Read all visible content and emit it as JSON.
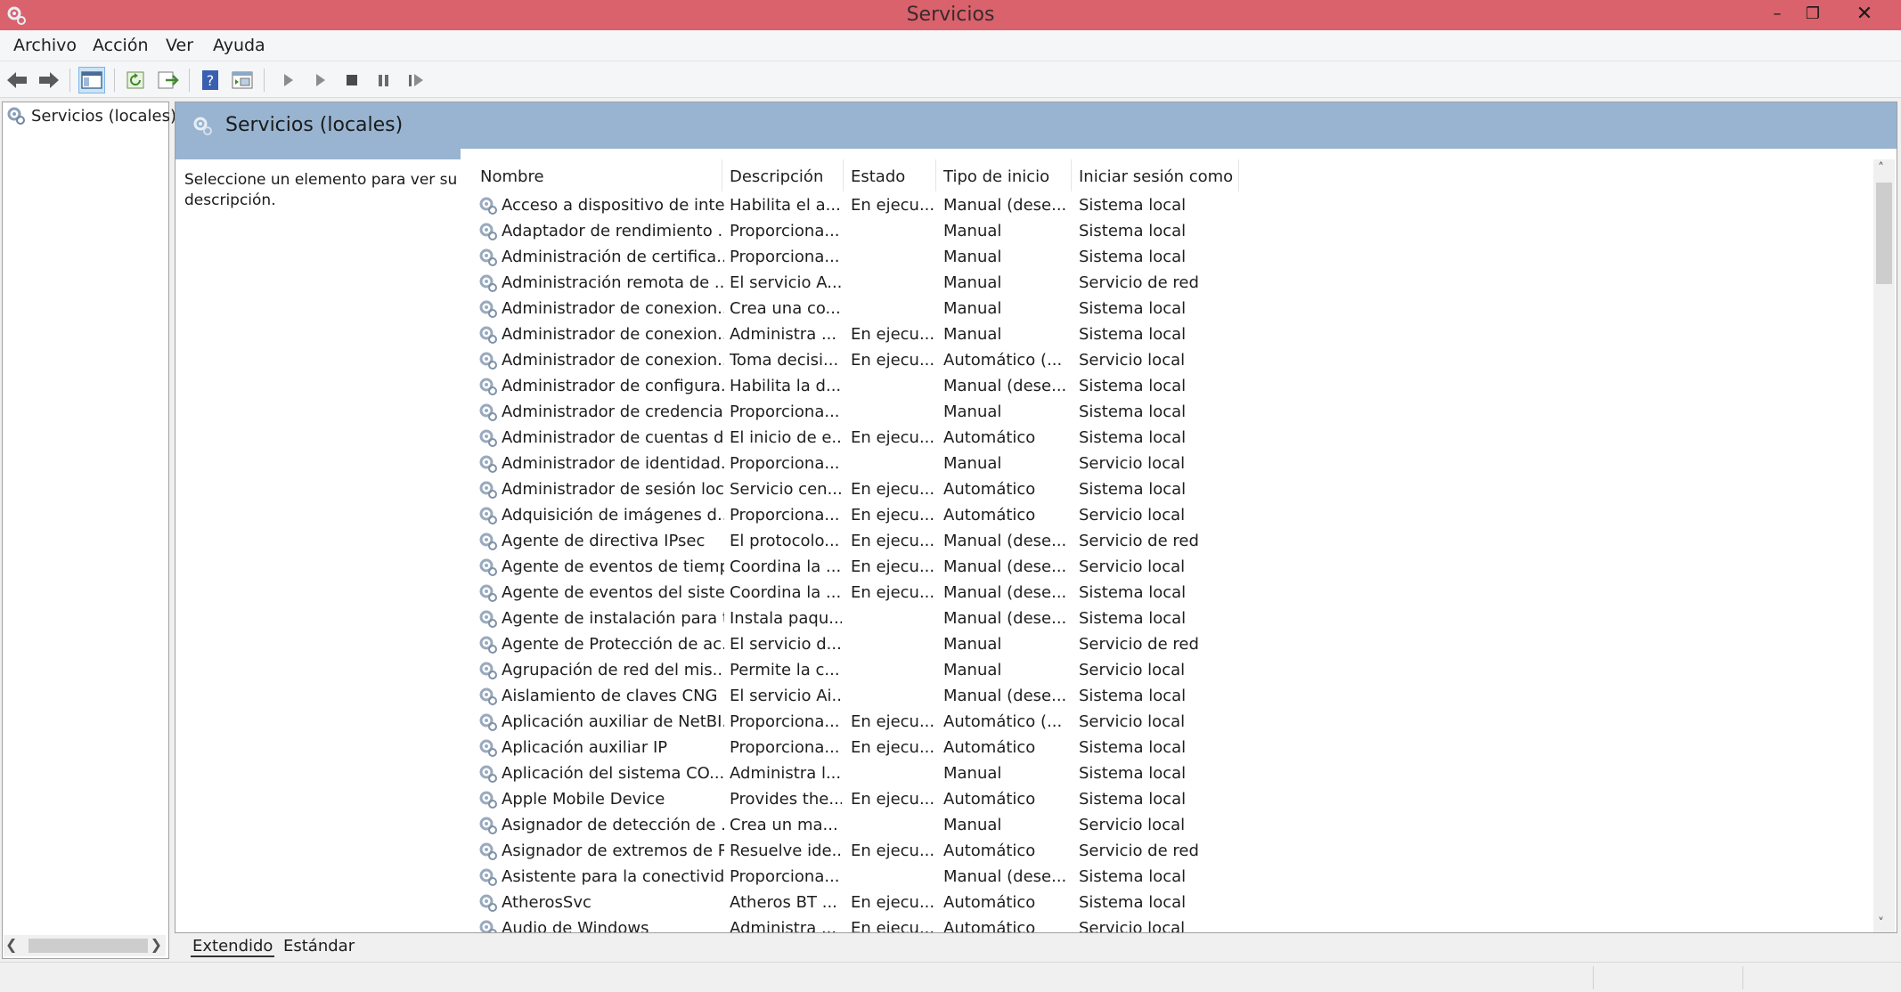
{
  "window": {
    "title": "Servicios",
    "minimize": "–",
    "maximize": "❐",
    "close": "✕"
  },
  "menu": {
    "items": [
      "Archivo",
      "Acción",
      "Ver",
      "Ayuda"
    ]
  },
  "tree": {
    "root_label": "Servicios (locales)"
  },
  "panel": {
    "title": "Servicios (locales)",
    "description": "Seleccione un elemento para ver su descripción."
  },
  "table": {
    "columns": [
      "Nombre",
      "Descripción",
      "Estado",
      "Tipo de inicio",
      "Iniciar sesión como"
    ],
    "rows": [
      [
        "Acceso a dispositivo de inte...",
        "Habilita el a...",
        "En ejecu...",
        "Manual (dese...",
        "Sistema local"
      ],
      [
        "Adaptador de rendimiento ...",
        "Proporciona...",
        "",
        "Manual",
        "Sistema local"
      ],
      [
        "Administración de certifica...",
        "Proporciona...",
        "",
        "Manual",
        "Sistema local"
      ],
      [
        "Administración remota de ...",
        "El servicio A...",
        "",
        "Manual",
        "Servicio de red"
      ],
      [
        "Administrador de conexion...",
        "Crea una co...",
        "",
        "Manual",
        "Sistema local"
      ],
      [
        "Administrador de conexion...",
        "Administra ...",
        "En ejecu...",
        "Manual",
        "Sistema local"
      ],
      [
        "Administrador de conexion...",
        "Toma decisi...",
        "En ejecu...",
        "Automático (...",
        "Servicio local"
      ],
      [
        "Administrador de configura...",
        "Habilita la d...",
        "",
        "Manual (dese...",
        "Sistema local"
      ],
      [
        "Administrador de credencia...",
        "Proporciona...",
        "",
        "Manual",
        "Sistema local"
      ],
      [
        "Administrador de cuentas d...",
        "El inicio de e...",
        "En ejecu...",
        "Automático",
        "Sistema local"
      ],
      [
        "Administrador de identidad...",
        "Proporciona...",
        "",
        "Manual",
        "Servicio local"
      ],
      [
        "Administrador de sesión local",
        "Servicio cen...",
        "En ejecu...",
        "Automático",
        "Sistema local"
      ],
      [
        "Adquisición de imágenes d...",
        "Proporciona...",
        "En ejecu...",
        "Automático",
        "Servicio local"
      ],
      [
        "Agente de directiva IPsec",
        "El protocolo...",
        "En ejecu...",
        "Manual (dese...",
        "Servicio de red"
      ],
      [
        "Agente de eventos de tiempo",
        "Coordina la ...",
        "En ejecu...",
        "Manual (dese...",
        "Servicio local"
      ],
      [
        "Agente de eventos del siste...",
        "Coordina la ...",
        "En ejecu...",
        "Manual (dese...",
        "Sistema local"
      ],
      [
        "Agente de instalación para t...",
        "Instala paqu...",
        "",
        "Manual (dese...",
        "Sistema local"
      ],
      [
        "Agente de Protección de ac...",
        "El servicio d...",
        "",
        "Manual",
        "Servicio de red"
      ],
      [
        "Agrupación de red del mis...",
        "Permite la c...",
        "",
        "Manual",
        "Servicio local"
      ],
      [
        "Aislamiento de claves CNG",
        "El servicio Ai...",
        "",
        "Manual (dese...",
        "Sistema local"
      ],
      [
        "Aplicación auxiliar de NetBI...",
        "Proporciona...",
        "En ejecu...",
        "Automático (...",
        "Servicio local"
      ],
      [
        "Aplicación auxiliar IP",
        "Proporciona...",
        "En ejecu...",
        "Automático",
        "Sistema local"
      ],
      [
        "Aplicación del sistema CO...",
        "Administra l...",
        "",
        "Manual",
        "Sistema local"
      ],
      [
        "Apple Mobile Device",
        "Provides the...",
        "En ejecu...",
        "Automático",
        "Sistema local"
      ],
      [
        "Asignador de detección de ...",
        "Crea un ma...",
        "",
        "Manual",
        "Servicio local"
      ],
      [
        "Asignador de extremos de R...",
        "Resuelve ide...",
        "En ejecu...",
        "Automático",
        "Servicio de red"
      ],
      [
        "Asistente para la conectivid...",
        "Proporciona...",
        "",
        "Manual (dese...",
        "Sistema local"
      ],
      [
        "AtherosSvc",
        "Atheros BT ...",
        "En ejecu...",
        "Automático",
        "Sistema local"
      ],
      [
        "Audio de Windows",
        "Administra ...",
        "En ejecu...",
        "Automático",
        "Servicio local"
      ]
    ]
  },
  "tabs": {
    "extended": "Extendido",
    "standard": "Estándar"
  }
}
